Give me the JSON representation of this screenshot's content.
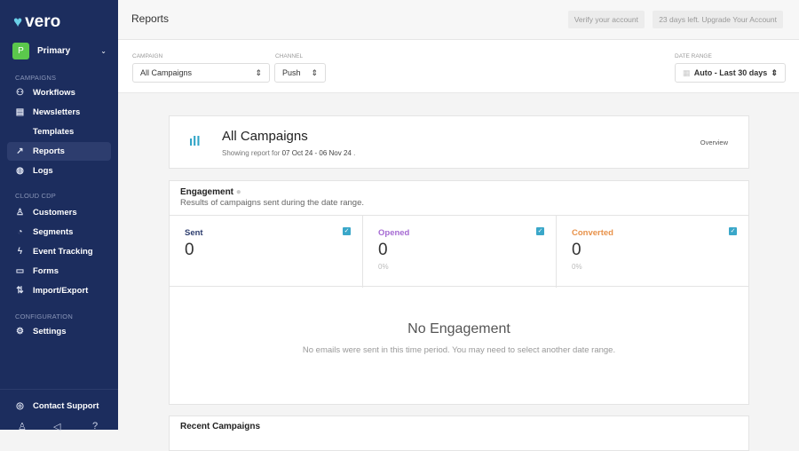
{
  "sidebar": {
    "logo": "vero",
    "account": {
      "initial": "P",
      "name": "Primary"
    },
    "sections": {
      "campaigns": "CAMPAIGNS",
      "cdp": "CLOUD CDP",
      "config": "CONFIGURATION"
    },
    "items": [
      {
        "label": "Workflows",
        "icon": "workflow-icon"
      },
      {
        "label": "Newsletters",
        "icon": "newsletter-icon"
      },
      {
        "label": "Templates",
        "icon": "code-icon"
      },
      {
        "label": "Reports",
        "icon": "chart-icon"
      },
      {
        "label": "Logs",
        "icon": "logs-icon"
      },
      {
        "label": "Customers",
        "icon": "user-icon"
      },
      {
        "label": "Segments",
        "icon": "pie-icon"
      },
      {
        "label": "Event Tracking",
        "icon": "bolt-icon"
      },
      {
        "label": "Forms",
        "icon": "form-icon"
      },
      {
        "label": "Import/Export",
        "icon": "import-export-icon"
      },
      {
        "label": "Settings",
        "icon": "gear-icon"
      }
    ],
    "contact": "Contact Support"
  },
  "header": {
    "title": "Reports",
    "verify": "Verify your account",
    "upgrade": "23 days left. Upgrade Your Account"
  },
  "filters": {
    "campaign_label": "CAMPAIGN",
    "campaign": "All Campaigns",
    "channel_label": "CHANNEL",
    "channel": "Push",
    "date_label": "DATE RANGE",
    "date": "Auto - Last 30 days"
  },
  "summary": {
    "title": "All Campaigns",
    "prefix": "Showing report for",
    "range": "07 Oct 24 - 06 Nov 24",
    "suffix": " .",
    "overview": "Overview"
  },
  "engagement": {
    "title": "Engagement",
    "subtitle": "Results of campaigns sent during the date range.",
    "stats": [
      {
        "label": "Sent",
        "value": "0",
        "pct": "",
        "color": "#2d3d6e"
      },
      {
        "label": "Opened",
        "value": "0",
        "pct": "0%",
        "color": "#a66bd3"
      },
      {
        "label": "Converted",
        "value": "0",
        "pct": "0%",
        "color": "#e8924a"
      }
    ],
    "empty_title": "No Engagement",
    "empty_text": "No emails were sent in this time period. You may need to select another date range."
  },
  "recent": {
    "title": "Recent Campaigns"
  },
  "colors": {
    "sidebar": "#1c2d5e",
    "accent": "#3aa7c9"
  }
}
